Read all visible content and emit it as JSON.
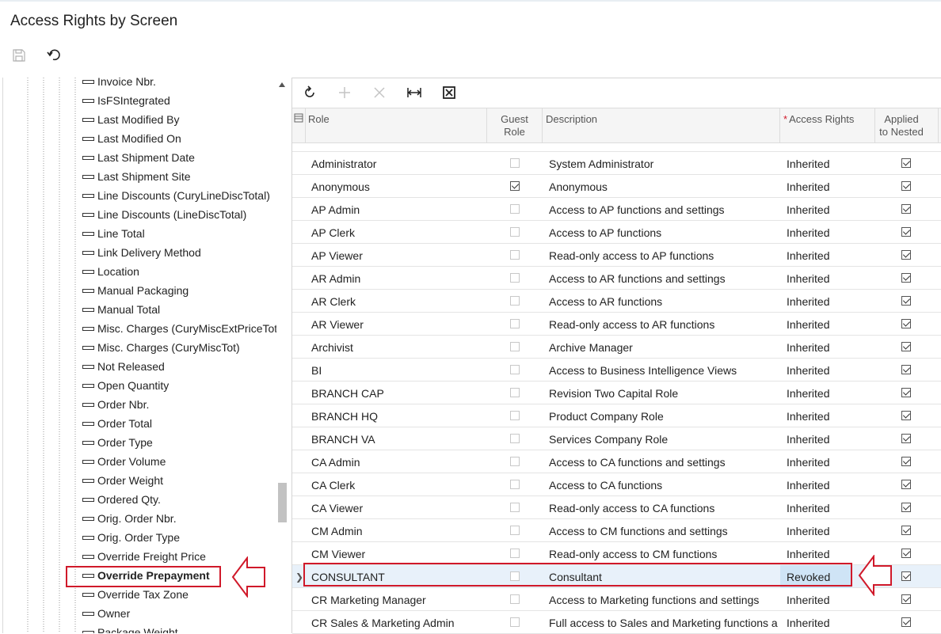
{
  "page": {
    "title": "Access Rights by Screen"
  },
  "toolbar": {
    "save_icon": "save-icon",
    "undo_icon": "undo-icon"
  },
  "tree": {
    "items": [
      "Invoice Nbr.",
      "IsFSIntegrated",
      "Last Modified By",
      "Last Modified On",
      "Last Shipment Date",
      "Last Shipment Site",
      "Line Discounts (CuryLineDiscTotal)",
      "Line Discounts (LineDiscTotal)",
      "Line Total",
      "Link Delivery Method",
      "Location",
      "Manual Packaging",
      "Manual Total",
      "Misc. Charges (CuryMiscExtPriceTotal)",
      "Misc. Charges (CuryMiscTot)",
      "Not Released",
      "Open Quantity",
      "Order Nbr.",
      "Order Total",
      "Order Type",
      "Order Volume",
      "Order Weight",
      "Ordered Qty.",
      "Orig. Order Nbr.",
      "Orig. Order Type",
      "Override Freight Price",
      "Override Prepayment",
      "Override Tax Zone",
      "Owner",
      "Package Weight"
    ],
    "selected_index": 26
  },
  "grid": {
    "toolbar_icons": [
      "refresh-icon",
      "add-icon",
      "delete-icon",
      "fit-columns-icon",
      "export-excel-icon"
    ],
    "columns": {
      "role": "Role",
      "guest_role_1": "Guest",
      "guest_role_2": "Role",
      "description": "Description",
      "required_mark": "*",
      "access_rights": "Access Rights",
      "applied_1": "Applied",
      "applied_2": "to Nested"
    },
    "rows": [
      {
        "role": "Administrator",
        "guest": false,
        "description": "System Administrator",
        "access": "Inherited",
        "nested": true
      },
      {
        "role": "Anonymous",
        "guest": true,
        "description": "Anonymous",
        "access": "Inherited",
        "nested": true
      },
      {
        "role": "AP Admin",
        "guest": false,
        "description": "Access to AP functions and settings",
        "access": "Inherited",
        "nested": true
      },
      {
        "role": "AP Clerk",
        "guest": false,
        "description": "Access to AP functions",
        "access": "Inherited",
        "nested": true
      },
      {
        "role": "AP Viewer",
        "guest": false,
        "description": "Read-only access to AP functions",
        "access": "Inherited",
        "nested": true
      },
      {
        "role": "AR Admin",
        "guest": false,
        "description": "Access to AR functions and settings",
        "access": "Inherited",
        "nested": true
      },
      {
        "role": "AR Clerk",
        "guest": false,
        "description": "Access to AR functions",
        "access": "Inherited",
        "nested": true
      },
      {
        "role": "AR Viewer",
        "guest": false,
        "description": "Read-only access to AR functions",
        "access": "Inherited",
        "nested": true
      },
      {
        "role": "Archivist",
        "guest": false,
        "description": "Archive Manager",
        "access": "Inherited",
        "nested": true
      },
      {
        "role": "BI",
        "guest": false,
        "description": "Access to Business Intelligence Views",
        "access": "Inherited",
        "nested": true
      },
      {
        "role": "BRANCH CAP",
        "guest": false,
        "description": "Revision Two Capital Role",
        "access": "Inherited",
        "nested": true
      },
      {
        "role": "BRANCH HQ",
        "guest": false,
        "description": "Product Company Role",
        "access": "Inherited",
        "nested": true
      },
      {
        "role": "BRANCH VA",
        "guest": false,
        "description": "Services Company Role",
        "access": "Inherited",
        "nested": true
      },
      {
        "role": "CA Admin",
        "guest": false,
        "description": "Access to CA functions and settings",
        "access": "Inherited",
        "nested": true
      },
      {
        "role": "CA Clerk",
        "guest": false,
        "description": "Access to CA functions",
        "access": "Inherited",
        "nested": true
      },
      {
        "role": "CA Viewer",
        "guest": false,
        "description": "Read-only access to CA functions",
        "access": "Inherited",
        "nested": true
      },
      {
        "role": "CM Admin",
        "guest": false,
        "description": "Access to CM functions and settings",
        "access": "Inherited",
        "nested": true
      },
      {
        "role": "CM Viewer",
        "guest": false,
        "description": "Read-only access to CM functions",
        "access": "Inherited",
        "nested": true
      },
      {
        "role": "CONSULTANT",
        "guest": false,
        "description": "Consultant",
        "access": "Revoked",
        "nested": true,
        "active": true
      },
      {
        "role": "CR Marketing Manager",
        "guest": false,
        "description": "Access to Marketing functions and settings",
        "access": "Inherited",
        "nested": true
      },
      {
        "role": "CR Sales & Marketing Admin",
        "guest": false,
        "description": "Full access to Sales and Marketing functions a…",
        "access": "Inherited",
        "nested": true
      }
    ]
  },
  "colors": {
    "accent_red": "#d0192a",
    "active_row": "#e8f1fa",
    "revoked_cell": "#cfe4f6"
  }
}
